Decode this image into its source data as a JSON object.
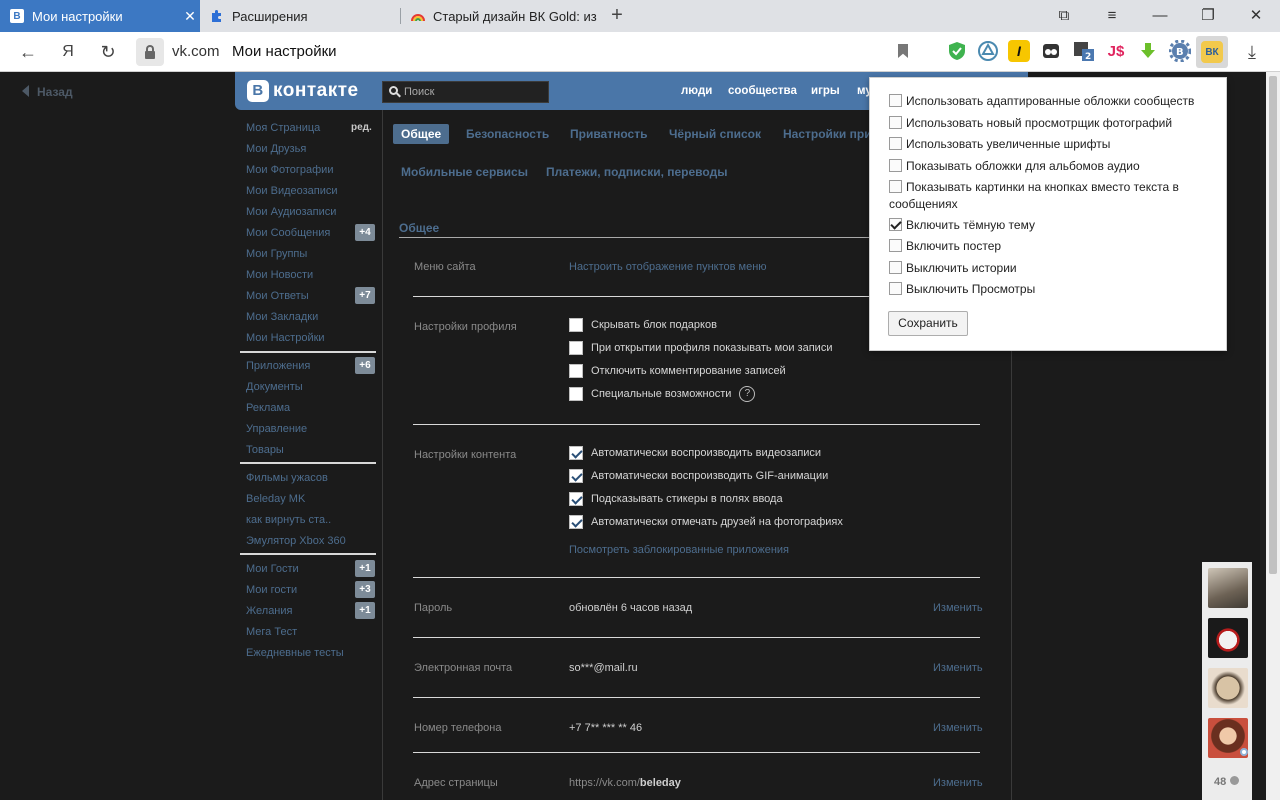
{
  "browser": {
    "tabs": [
      {
        "title": "Мои настройки",
        "favicon": "В",
        "active": true
      },
      {
        "title": "Расширения",
        "favicon": "puzzle-icon",
        "active": false
      },
      {
        "title": "Старый дизайн ВК Gold: из",
        "favicon": "rainbow-icon",
        "active": false
      }
    ],
    "close_glyph": "✕",
    "new_tab_glyph": "+",
    "address": {
      "domain": "vk.com",
      "title": "Мои настройки"
    },
    "nav_glyphs": {
      "back": "←",
      "yandex": "Я",
      "reload": "↻",
      "download": "⤓"
    },
    "window_glyphs": {
      "bookmarks": "⧉",
      "menu": "≡",
      "minimize": "—",
      "restore": "❐",
      "close": "✕"
    },
    "extensions": [
      {
        "name": "adguard",
        "label": "✓",
        "color": "#3fb34f"
      },
      {
        "name": "triangle-ext",
        "label": "△",
        "color": "#4b8ab0"
      },
      {
        "name": "i-ext",
        "label": "I",
        "color": "#f7c600"
      },
      {
        "name": "glasses-ext",
        "label": "◉",
        "color": "#333333"
      },
      {
        "name": "translate-ext",
        "label": "2",
        "color": "#4b78b0"
      },
      {
        "name": "js-ext",
        "label": "J$",
        "color": "#ffffff"
      },
      {
        "name": "download-ext",
        "label": "⬇",
        "color": "#6cbf2a"
      },
      {
        "name": "gear-vk-ext",
        "label": "В",
        "color": "#5a7fae"
      },
      {
        "name": "vk-gold-ext",
        "label": "ВК",
        "color": "#f2c94c"
      }
    ]
  },
  "page": {
    "back_label": "Назад",
    "header": {
      "logo_letter": "В",
      "logo_text": "контакте",
      "search_placeholder": "Поиск",
      "nav": [
        "люди",
        "сообщества",
        "игры",
        "му"
      ]
    },
    "left_menu": {
      "group1": [
        {
          "label": "Моя Страница",
          "extra": "ред."
        },
        {
          "label": "Мои Друзья"
        },
        {
          "label": "Мои Фотографии"
        },
        {
          "label": "Мои Видеозаписи"
        },
        {
          "label": "Мои Аудиозаписи"
        },
        {
          "label": "Мои Сообщения",
          "badge": "+4"
        },
        {
          "label": "Мои Группы"
        },
        {
          "label": "Мои Новости"
        },
        {
          "label": "Мои Ответы",
          "badge": "+7"
        },
        {
          "label": "Мои Закладки"
        },
        {
          "label": "Мои Настройки"
        }
      ],
      "group2": [
        {
          "label": "Приложения",
          "badge": "+6"
        },
        {
          "label": "Документы"
        },
        {
          "label": "Реклама"
        },
        {
          "label": "Управление"
        },
        {
          "label": "Товары"
        }
      ],
      "group3": [
        {
          "label": "Фильмы ужасов"
        },
        {
          "label": "Beleday MK"
        },
        {
          "label": "как вирнуть ста.."
        },
        {
          "label": "Эмулятор Xbox 360"
        }
      ],
      "group4": [
        {
          "label": "Мои Гости",
          "badge": "+1"
        },
        {
          "label": "Мои гости",
          "badge": "+3"
        },
        {
          "label": "Желания",
          "badge": "+1"
        },
        {
          "label": "Мега Тест"
        },
        {
          "label": "Ежедневные тесты"
        }
      ]
    },
    "settings_tabs": {
      "row1": [
        "Общее",
        "Безопасность",
        "Приватность",
        "Чёрный список",
        "Настройки при"
      ],
      "row2": [
        "Мобильные сервисы",
        "Платежи, подписки, переводы"
      ]
    },
    "section_title": "Общее",
    "site_menu": {
      "label": "Меню сайта",
      "link": "Настроить отображение пунктов меню"
    },
    "profile_settings": {
      "label": "Настройки профиля",
      "options": [
        {
          "text": "Скрывать блок подарков",
          "checked": false
        },
        {
          "text": "При открытии профиля показывать мои записи",
          "checked": false
        },
        {
          "text": "Отключить комментирование записей",
          "checked": false
        },
        {
          "text": "Специальные возможности",
          "checked": false
        }
      ],
      "help_glyph": "?"
    },
    "content_settings": {
      "label": "Настройки контента",
      "options": [
        {
          "text": "Автоматически воспроизводить видеозаписи",
          "checked": true
        },
        {
          "text": "Автоматически воспроизводить GIF-анимации",
          "checked": true
        },
        {
          "text": "Подсказывать стикеры в полях ввода",
          "checked": true
        },
        {
          "text": "Автоматически отмечать друзей на фотографиях",
          "checked": true
        }
      ],
      "link": "Посмотреть заблокированные приложения"
    },
    "password": {
      "label": "Пароль",
      "value": "обновлён 6 часов назад",
      "action": "Изменить"
    },
    "email": {
      "label": "Электронная почта",
      "value": "so***@mail.ru",
      "action": "Изменить"
    },
    "phone": {
      "label": "Номер телефона",
      "value": "+7 7** *** ** 46",
      "action": "Изменить"
    },
    "address": {
      "label": "Адрес страницы",
      "value_prefix": "https://vk.com/",
      "value_id": "beleday",
      "action": "Изменить"
    },
    "friends_count": "48"
  },
  "popup": {
    "options": [
      {
        "text": "Использовать адаптированные обложки сообществ",
        "checked": false
      },
      {
        "text": "Использовать новый просмотрщик фотографий",
        "checked": false
      },
      {
        "text": "Использовать увеличенные шрифты",
        "checked": false
      },
      {
        "text": "Показывать обложки для альбомов аудио",
        "checked": false
      },
      {
        "text": "Показывать картинки на кнопках вместо текста в сообщениях",
        "checked": false
      },
      {
        "text": "Включить тёмную тему",
        "checked": true
      },
      {
        "text": "Включить постер",
        "checked": false
      },
      {
        "text": "Выключить истории",
        "checked": false
      },
      {
        "text": "Выключить Просмотры",
        "checked": false
      }
    ],
    "save_label": "Сохранить"
  },
  "colors": {
    "vk_blue": "#4a76a8",
    "link": "#4d6d8e",
    "tab_active": "#3c78c3"
  }
}
